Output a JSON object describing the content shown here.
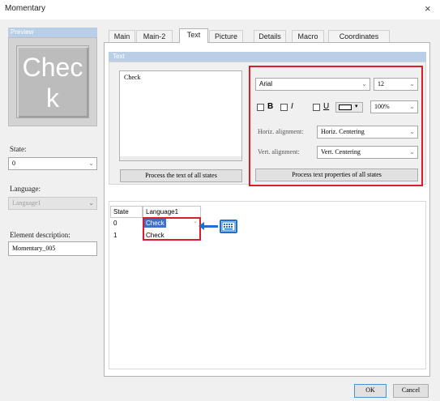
{
  "window": {
    "title": "Momentary",
    "close_glyph": "×"
  },
  "left": {
    "preview_header": "Preview",
    "preview_text": "Check",
    "state_label": "State:",
    "state_value": "0",
    "language_label": "Language:",
    "language_value": "Language1",
    "element_desc_label": "Element description:",
    "element_desc_value": "Momentary_005"
  },
  "tabs": [
    {
      "label": "Main",
      "active": false
    },
    {
      "label": "Main-2",
      "active": false
    },
    {
      "label": "Text",
      "active": true
    },
    {
      "label": "Picture",
      "active": false
    },
    {
      "label": "Details",
      "active": false
    },
    {
      "label": "Macro",
      "active": false
    },
    {
      "label": "Coordinates",
      "active": false
    }
  ],
  "text_section": {
    "header": "Text",
    "text_value": "Check",
    "process_all_states_button": "Process the text of all states",
    "font_name": "Arial",
    "font_size": "12",
    "bold_label": "B",
    "italic_label": "I",
    "underline_label": "U",
    "color_swatch": "#ffffff",
    "scale": "100%",
    "horiz_label": "Horiz. alignment:",
    "horiz_value": "Horiz. Centering",
    "vert_label": "Vert. alignment:",
    "vert_value": "Vert. Centering",
    "process_properties_button": "Process text properties of all states"
  },
  "grid": {
    "columns": [
      "State",
      "Language1"
    ],
    "rows": [
      {
        "state": "0",
        "language1": "Check",
        "editing": true
      },
      {
        "state": "1",
        "language1": "Check",
        "editing": false
      }
    ]
  },
  "footer": {
    "ok": "OK",
    "cancel": "Cancel"
  },
  "colors": {
    "highlight_red": "#dc1c2c",
    "keyboard_blue": "#1d6fd0",
    "selection_blue": "#3f70c9",
    "header_blue": "#b9cfe8"
  },
  "icons": [
    "close-icon",
    "dropdown-arrow-icon",
    "color-dropdown-icon",
    "keyboard-icon",
    "arrow-left-icon"
  ]
}
